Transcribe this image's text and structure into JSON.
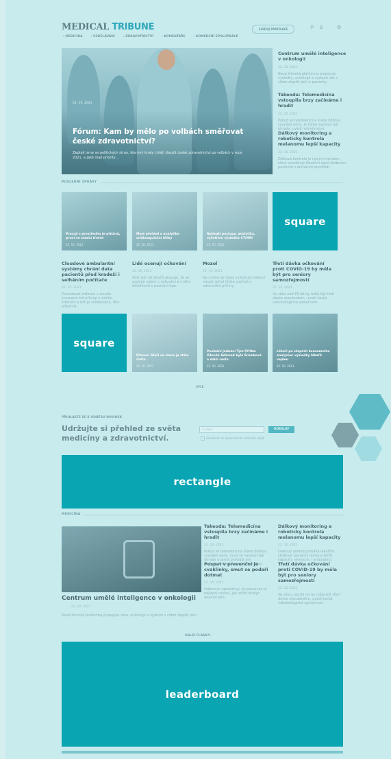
{
  "header": {
    "logo_part1": "MEDICAL",
    "logo_part2": "TRIBUNE",
    "nav": [
      "MEDICÍNA",
      "VZDĚLÁVÁNÍ",
      "ZDRAVOTNICTVÍ",
      "KOMENTÁŘE",
      "KOMERČNÍ SPOLUPRÁCE"
    ],
    "pill_label": "SLEDUJ PROFILACE",
    "icons": [
      "search-icon",
      "user-icon",
      "settings-icon"
    ]
  },
  "hero": {
    "title": "Fórum: Kam by mělo po volbách směřovat české zdravotnictví?",
    "perex": "Zeptali jsme se politických stran, kterými kroky chtějí zlepšit české zdravotnictví po volbách v roce 2021, a jaké mají priority…",
    "date": "22. 10. 2021"
  },
  "sidebar_news": [
    {
      "title": "Centrum umělé inteligence v onkologii",
      "date": "22. 10. 2021",
      "text": "Nová klinická platforma propojuje výsledky, onkologii a výzkum dat s cílem zlepšit péči o pacienty."
    },
    {
      "title": "Takeoda: Telemedicína vstoupila brzy začínáme i hradit",
      "date": "22. 10. 2021",
      "text": "Pokud se telemedicína stane běžnou součástí péče, je třeba nastavit její úhrady, uvádí ministerstvo."
    },
    {
      "title": "Dálkový monitoring a roboticky kontrola melanomu lepší kapacity",
      "date": "22. 10. 2021",
      "text": "Dálková kontrola je novým trendem, který umožňuje lékařům lepší sledování pacientů v domácím prostředí."
    }
  ],
  "section_latest": "POSLEDNÍ ZPRÁVY",
  "cards_row1": [
    {
      "caption": "Pracují s prostředím je přístroj, první ve stádiu třetím",
      "date": "22. 10. 2021"
    },
    {
      "caption": "Moje přehled a analytika antikoagulační léčby",
      "date": "22. 10. 2021"
    },
    {
      "caption": "Nejlepší postupy, analytika, vyšetření výsledků CT/MRI",
      "date": "22. 10. 2021"
    }
  ],
  "news_row": [
    {
      "title": "Cloudové ambulantní systémy chrání data pacientů před kradeží i selháním počítače",
      "date": "22. 10. 2021",
      "text": "Provozovat ordinaci v cloudu znamená mít přístup k datům kdekoliv a mít je zálohována, říká odborník."
    },
    {
      "title": "Lidé ocenují očkování",
      "date": "22. 10. 2021",
      "text": "Sběr dat od lékařů ukazuje, že se zvyšuje zájem o očkování a v jeho důležitosti o poznání lépe."
    },
    {
      "title": "Mozol",
      "date": "22. 10. 2021",
      "text": "Na nohou se často vyskytuje tlakový mozol, jehož léčba spočívá v odstranění příčiny."
    },
    {
      "title": "Třetí dávka očkování proti COVID-19 by měla být pro seniory samozřejmostí",
      "date": "22. 10. 2021",
      "text": "Ve věku nad 65 let by měla být třetí dávka standardem, uvádí česká vakcinologická společnost."
    }
  ],
  "cards_row2": [
    {
      "caption": "Pitevní: Stáří ve stavu je stále často",
      "date": "22. 10. 2021"
    },
    {
      "caption": "Poslední jednání Tým Přítko: Zdeněk Adámek byla Šrámková a další cesta",
      "date": "22. 10. 2021"
    },
    {
      "caption": "Lékaři po stopách konzumního analýzou: výsledky lékařů vejdou",
      "date": "22. 10. 2021"
    }
  ],
  "more_link": "VÍCE",
  "newsletter": {
    "eyebrow": "PŘIHLASTE SE K ODBĚRU NOVINEK",
    "heading": "Udržujte si přehled ze světa medicíny a zdravotnictví.",
    "email_placeholder": "E-mail",
    "submit_label": "ODESLAT",
    "consent": "Souhlasím se zpracováním osobních údajů"
  },
  "section_medicine": "MEDICÍNA",
  "feature": {
    "title": "Centrum umělé inteligence v onkologii",
    "date": "22. 10. 2021",
    "text": "Nová klinická platforma propojuje data, onkologii a výzkum s cílem zlepšit péči."
  },
  "medicine_list": [
    {
      "title": "Takeoda: Telemedicína vstoupila brzy začínáme i hradit",
      "date": "22. 10. 2021",
      "text": "Pokud se telemedicína stane běžnou součástí péče, musí se nastavit její úhrady a jasná pravidla pro poskytovatele zdravotních služeb."
    },
    {
      "title": "Dálkový monitoring a roboticky kontrola melanomu lepší kapacity",
      "date": "22. 10. 2021",
      "text": "Dálkový dohled pomáhá lékařům sledovat pacienty doma a šetřit kapacity nemocnic i ambulancí."
    },
    {
      "title": "Pospat v prevenční je cvaklinky, smut se podaří dotmat",
      "date": "22. 10. 2021",
      "text": "Odborníci upozorňují, že prevence je nejlepší cestou, jak snížit výskyt onemocnění."
    },
    {
      "title": "Třetí dávka očkování proti COVID-19 by měla být pro seniory samozřejmostí",
      "date": "22. 10. 2021",
      "text": "Ve věku nad 65 let by měla být třetí dávka standardem, uvádí česká vakcinologická společnost."
    }
  ],
  "more_articles": "DALŠÍ ČLÁNKY ›",
  "ads": {
    "square1": "square",
    "square2": "square",
    "rectangle": "rectangle",
    "leaderboard": "leaderboard"
  },
  "colors": {
    "accent": "#0aa5b3",
    "page_bg": "#c8ebee"
  }
}
